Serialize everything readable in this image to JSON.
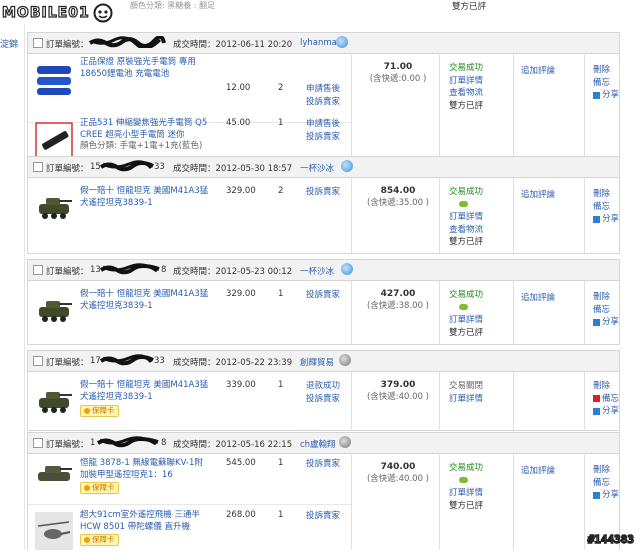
{
  "logo": {
    "text": "MOBILE01"
  },
  "sidebar": {
    "label": "淀錦"
  },
  "top": {
    "snippet": "顏色分類: 黑糖養 : 翻足",
    "right": "雙方已評"
  },
  "labels": {
    "order_no": "訂單編號：",
    "time_prefix": "成交時間："
  },
  "orders": [
    {
      "num_visible": "",
      "time": "2012-06-11 20:20",
      "seller": "lyhanma",
      "items": [
        {
          "thumb": "blue-flashlights",
          "title": "正品保證 原裝強光手電筒 專用 18650鋰電池 充電電池",
          "price": "12.00",
          "qty": "2",
          "actions": [
            "申請售後",
            "投訴賣家"
          ]
        },
        {
          "thumb": "black-flashlight",
          "title": "正品531 伸縮變焦強光手電筒 Q5 CREE 超亮小型手電筒 迷你",
          "sub": "顏色分類: 手電+1電+1充(藍色)",
          "price": "45.00",
          "qty": "1",
          "actions": [
            "申請售後",
            "投訴賣家"
          ]
        }
      ],
      "amount": "71.00",
      "shipping": "(含快遞:0.00 )",
      "status": [
        "交易成功",
        "訂單詳情",
        "查看物流",
        "雙方已評"
      ],
      "review": "追加評論",
      "ops": [
        "刪除",
        "備忘",
        "分享"
      ]
    },
    {
      "num_visible": "15",
      "num_tail": "33",
      "time": "2012-05-30 18:57",
      "seller": "一杯沙冰",
      "items": [
        {
          "thumb": "tank",
          "title": "假一賠十 恒龍坦克 美國M41A3猛犬遙控坦克3839-1",
          "price": "329.00",
          "qty": "2",
          "actions": [
            "投訴賣家"
          ]
        }
      ],
      "amount": "854.00",
      "shipping": "(含快遞:35.00 )",
      "status": [
        "交易成功",
        "訂單詳情",
        "查看物流",
        "雙方已評"
      ],
      "review": "追加評論",
      "ops": [
        "刪除",
        "備忘",
        "分享"
      ]
    },
    {
      "num_visible": "13",
      "num_tail": "8",
      "time": "2012-05-23 00:12",
      "seller": "一杯沙冰",
      "items": [
        {
          "thumb": "tank",
          "title": "假一賠十 恒龍坦克 美國M41A3猛犬遙控坦克3839-1",
          "price": "329.00",
          "qty": "1",
          "actions": [
            "投訴賣家"
          ]
        }
      ],
      "amount": "427.00",
      "shipping": "(含快遞:38.00 )",
      "status": [
        "交易成功",
        "訂單詳情",
        "雙方已評"
      ],
      "review": "追加評論",
      "ops": [
        "刪除",
        "備忘",
        "分享"
      ]
    },
    {
      "num_visible": "17",
      "num_tail": "33",
      "time": "2012-05-22 23:39",
      "seller": "創輝貿易",
      "items": [
        {
          "thumb": "tank",
          "title": "假一賠十 恒龍坦克 美國M41A3猛犬遙控坦克3839-1",
          "price": "339.00",
          "qty": "1",
          "badge": "保障卡",
          "actions": [
            "退款成功",
            "投訴賣家"
          ]
        }
      ],
      "amount": "379.00",
      "shipping": "(含快遞:40.00 )",
      "status": [
        "交易關閉",
        "訂單詳情"
      ],
      "review": "",
      "ops": [
        "刪除",
        "備忘",
        "分享"
      ]
    },
    {
      "num_visible": "1",
      "num_tail": "8",
      "time": "2012-05-16 22:15",
      "seller": "ch盧翰翔",
      "items": [
        {
          "thumb": "tank2",
          "title": "恒龍 3878-1 無線電蘇聯KV-1附加裝甲型遙控坦克1：16",
          "price": "545.00",
          "qty": "1",
          "badge": "保障卡",
          "actions": [
            "投訴賣家"
          ]
        },
        {
          "thumb": "helicopter",
          "title": "超大91cm室外遙控飛機 三通半 HCW 8501 帶陀螺儀 直升機",
          "price": "268.00",
          "qty": "1",
          "badge": "保障卡",
          "actions": [
            "投訴賣家"
          ]
        }
      ],
      "amount": "740.00",
      "shipping": "(含快遞:40.00 )",
      "status": [
        "交易成功",
        "訂單詳情",
        "雙方已評"
      ],
      "review": "追加評論",
      "ops": [
        "刪除",
        "備忘",
        "分享"
      ]
    }
  ],
  "watermark": "#144383"
}
